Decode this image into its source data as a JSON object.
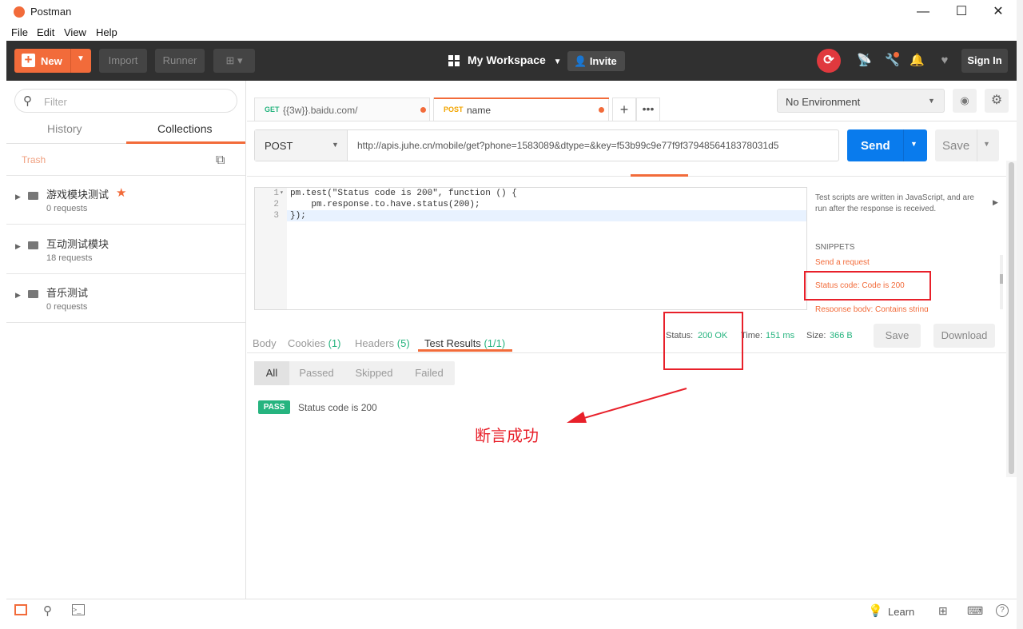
{
  "window": {
    "title": "Postman",
    "minimize": "—",
    "maximize": "☐",
    "close": "✕"
  },
  "menu": [
    "File",
    "Edit",
    "View",
    "Help"
  ],
  "toolbar": {
    "new_label": "New",
    "import_label": "Import",
    "runner_label": "Runner",
    "workspace": "My Workspace",
    "invite_label": "Invite",
    "signin_label": "Sign In"
  },
  "sidebar": {
    "filter_placeholder": "Filter",
    "tab_history": "History",
    "tab_collections": "Collections",
    "trash_label": "Trash",
    "collections": [
      {
        "name": "游戏模块测试",
        "requests": "0 requests",
        "starred": true
      },
      {
        "name": "互动测试模块",
        "requests": "18 requests",
        "starred": false
      },
      {
        "name": "音乐测试",
        "requests": "0 requests",
        "starred": false
      }
    ]
  },
  "tabs": [
    {
      "method": "GET",
      "name": "{{3w}}.baidu.com/"
    },
    {
      "method": "POST",
      "name": "name"
    }
  ],
  "environment": "No Environment",
  "request": {
    "method": "POST",
    "url": "http://apis.juhe.cn/mobile/get?phone=1583089&dtype=&key=f53b99c9e77f9f3794856418378031d5",
    "send_label": "Send",
    "save_label": "Save"
  },
  "editor": {
    "lines": [
      {
        "num": "1",
        "text": "pm.test(\"Status code is 200\", function () {"
      },
      {
        "num": "2",
        "text": "    pm.response.to.have.status(200);"
      },
      {
        "num": "3",
        "text": "});"
      }
    ]
  },
  "snippets": {
    "description": "Test scripts are written in JavaScript, and are run after the response is received.",
    "heading": "SNIPPETS",
    "items": [
      "Send a request",
      "Status code: Code is 200",
      "Response body: Contains string"
    ]
  },
  "response": {
    "tabs": {
      "body": "Body",
      "cookies": "Cookies",
      "cookies_count": "(1)",
      "headers": "Headers",
      "headers_count": "(5)",
      "tests": "Test Results",
      "tests_count": "(1/1)"
    },
    "status_label": "Status:",
    "status_value": "200 OK",
    "time_label": "Time:",
    "time_value": "151 ms",
    "size_label": "Size:",
    "size_value": "366 B",
    "save_label": "Save",
    "download_label": "Download",
    "filters": [
      "All",
      "Passed",
      "Skipped",
      "Failed"
    ],
    "result_badge": "PASS",
    "result_text": "Status code is 200"
  },
  "annotation": "断言成功",
  "statusbar": {
    "learn_label": "Learn"
  },
  "colors": {
    "accent": "#f26b3a",
    "send": "#097bed",
    "pass": "#26b47f",
    "annotation": "#e8202a"
  }
}
